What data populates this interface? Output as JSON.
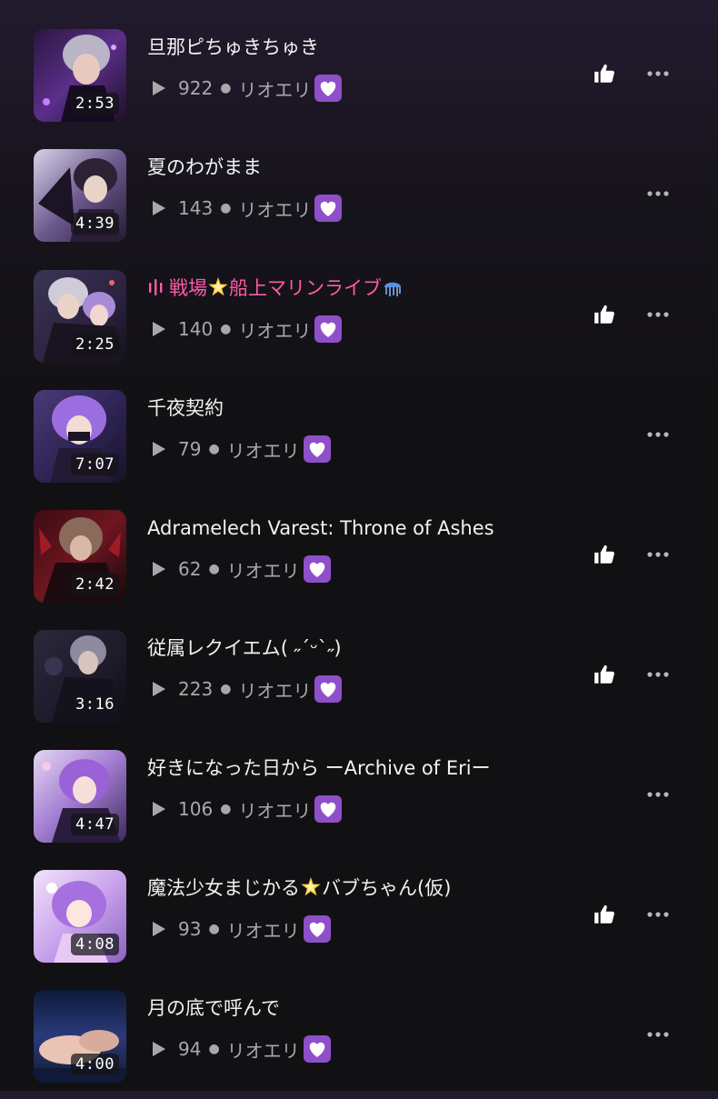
{
  "tracks": [
    {
      "title": "旦那ピちゅきちゅき",
      "duration": "2:53",
      "plays": "922",
      "artist": "リオエリ",
      "liked": true,
      "live": false
    },
    {
      "title": "夏のわがまま",
      "duration": "4:39",
      "plays": "143",
      "artist": "リオエリ",
      "liked": false,
      "live": false
    },
    {
      "title_prefix": "戦場",
      "title_middle": "船上マリンライブ",
      "duration": "2:25",
      "plays": "140",
      "artist": "リオエリ",
      "liked": true,
      "live": true
    },
    {
      "title": "千夜契約",
      "duration": "7:07",
      "plays": "79",
      "artist": "リオエリ",
      "liked": false,
      "live": false
    },
    {
      "title": "Adramelech Varest: Throne of Ashes",
      "duration": "2:42",
      "plays": "62",
      "artist": "リオエリ",
      "liked": true,
      "live": false
    },
    {
      "title": "従属レクイエム( ˶ˊᵕˋ˶)",
      "duration": "3:16",
      "plays": "223",
      "artist": "リオエリ",
      "liked": true,
      "live": false
    },
    {
      "title": "好きになった日から ーArchive of Eriー",
      "duration": "4:47",
      "plays": "106",
      "artist": "リオエリ",
      "liked": false,
      "live": false
    },
    {
      "title_prefix": "魔法少女まじかる",
      "title_middle": "バブちゃん(仮)",
      "duration": "4:08",
      "plays": "93",
      "artist": "リオエリ",
      "liked": true,
      "live": false
    },
    {
      "title": "月の底で呼んで",
      "duration": "4:00",
      "plays": "94",
      "artist": "リオエリ",
      "liked": false,
      "live": false
    }
  ],
  "icons": {
    "play": "play-icon",
    "like": "thumbs-up-icon",
    "more": "more-icon",
    "heart": "purple-heart-icon"
  },
  "colors": {
    "live_title": "#ff5aa8",
    "meta_text": "#a8a8ac",
    "heart_bg": "#8e4fc9"
  }
}
